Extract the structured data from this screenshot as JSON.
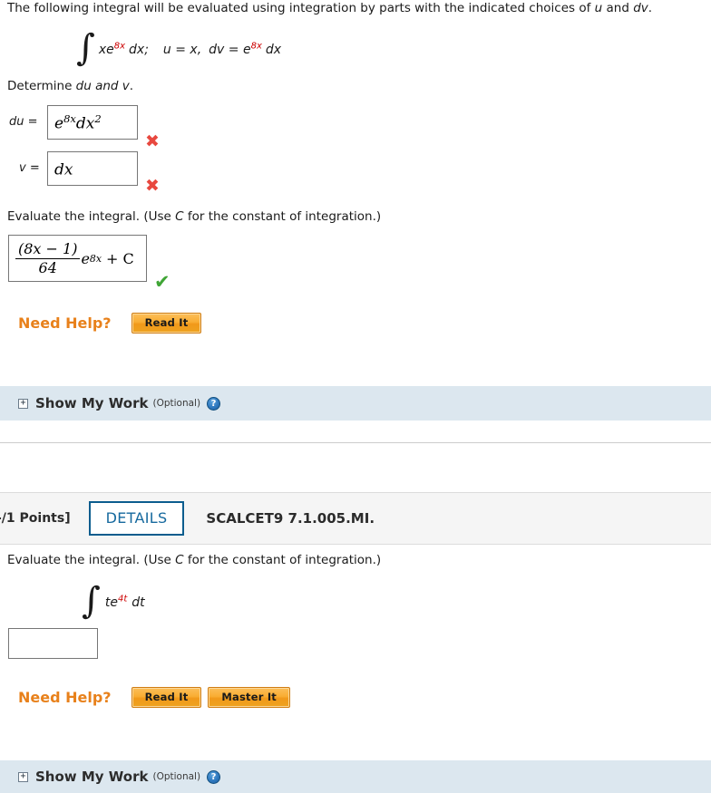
{
  "question1": {
    "intro_text_pre": "The following integral will be evaluated using integration by parts with the indicated choices of ",
    "intro_u": "u",
    "intro_and": " and ",
    "intro_dv": "dv",
    "intro_end": ".",
    "problem_integral": {
      "integral_symbol": "∫",
      "integrand": "xe",
      "exponent": "8x",
      "differential": "dx;",
      "u_assignment": "u = x,",
      "dv_assignment_pre": "dv = e",
      "dv_exponent": "8x",
      "dv_assignment_post": "dx"
    },
    "determine_pre": "Determine ",
    "determine_it": "du and v",
    "determine_post": ".",
    "fields": [
      {
        "label": "du  =",
        "value_base": "e",
        "value_sup": "8x",
        "value_tail": "dx",
        "value_tail_sup": "2",
        "status": "incorrect",
        "status_glyph": "✖"
      },
      {
        "label": "v  =",
        "value_base": "dx",
        "value_sup": "",
        "value_tail": "",
        "value_tail_sup": "",
        "status": "incorrect",
        "status_glyph": "✖"
      }
    ],
    "evaluate_pre": "Evaluate the integral. (Use ",
    "evaluate_c": "C",
    "evaluate_post": " for the constant of integration.)",
    "answer": {
      "numerator": "(8x − 1)",
      "denominator": "64",
      "factor_base": "e",
      "factor_sup": "8x",
      "plus_c": "+ C",
      "status": "correct",
      "status_glyph": "✔"
    },
    "need_help_label": "Need Help?",
    "help_buttons": [
      "Read It"
    ],
    "show_my_work": {
      "expander": "+",
      "title": "Show My Work",
      "optional": "(Optional)",
      "help_icon": "?"
    }
  },
  "question2": {
    "points": "-/1 Points]",
    "details_label": "DETAILS",
    "question_code": "SCALCET9 7.1.005.MI.",
    "evaluate_pre": "Evaluate the integral. (Use ",
    "evaluate_c": "C",
    "evaluate_post": " for the constant of integration.)",
    "problem_integral": {
      "integral_symbol": "∫",
      "integrand": "te",
      "exponent": "4t",
      "differential": "dt"
    },
    "answer_value": "",
    "answer_placeholder": "",
    "need_help_label": "Need Help?",
    "help_buttons": [
      "Read It",
      "Master It"
    ],
    "show_my_work": {
      "expander": "+",
      "title": "Show My Work",
      "optional": "(Optional)",
      "help_icon": "?"
    }
  },
  "colors": {
    "accent_orange": "#e8811b",
    "incorrect_red": "#e8483f",
    "correct_green": "#3fa535",
    "details_blue": "#16699e",
    "smw_bar_blue": "#dce7ef",
    "math_red": "#cc0000"
  }
}
